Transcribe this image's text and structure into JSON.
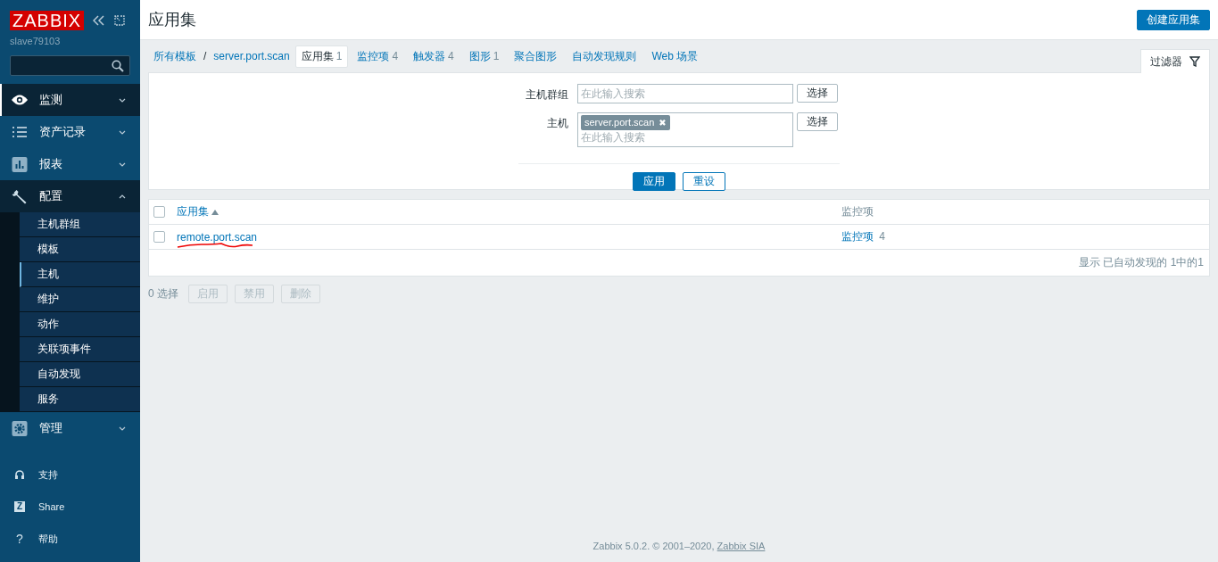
{
  "sidebar": {
    "logo": "ZABBIX",
    "server": "slave79103",
    "menu": [
      {
        "label": "监测",
        "selected": true,
        "expanded": false
      },
      {
        "label": "资产记录",
        "selected": false,
        "expanded": false
      },
      {
        "label": "报表",
        "selected": false,
        "expanded": false
      },
      {
        "label": "配置",
        "selected": true,
        "expanded": true,
        "children": [
          {
            "label": "主机群组",
            "selected": false
          },
          {
            "label": "模板",
            "selected": false
          },
          {
            "label": "主机",
            "selected": true
          },
          {
            "label": "维护",
            "selected": false
          },
          {
            "label": "动作",
            "selected": false
          },
          {
            "label": "关联项事件",
            "selected": false
          },
          {
            "label": "自动发现",
            "selected": false
          },
          {
            "label": "服务",
            "selected": false
          }
        ]
      },
      {
        "label": "管理",
        "selected": false,
        "expanded": false
      }
    ],
    "links": [
      {
        "label": "支持",
        "kind": "headset"
      },
      {
        "label": "Share",
        "kind": "glyph",
        "glyph": "Z"
      },
      {
        "label": "帮助",
        "kind": "plain",
        "glyph": "?"
      }
    ]
  },
  "header": {
    "title": "应用集",
    "create_button": "创建应用集"
  },
  "nav": [
    {
      "label": "所有模板",
      "kind": "link"
    },
    {
      "label": "/",
      "kind": "separator"
    },
    {
      "label": "server.port.scan",
      "kind": "link"
    },
    {
      "label": "应用集",
      "kind": "tab",
      "count": "1",
      "selected": true
    },
    {
      "label": "监控项",
      "kind": "tab",
      "count": "4",
      "selected": false
    },
    {
      "label": "触发器",
      "kind": "tab",
      "count": "4",
      "selected": false
    },
    {
      "label": "图形",
      "kind": "tab",
      "count": "1",
      "selected": false
    },
    {
      "label": "聚合图形",
      "kind": "tab",
      "selected": false
    },
    {
      "label": "自动发现规则",
      "kind": "tab",
      "selected": false
    },
    {
      "label": "Web 场景",
      "kind": "tab",
      "selected": false
    }
  ],
  "filter": {
    "tab": "过滤器",
    "fields": [
      {
        "label": "主机群组",
        "placeholder": "在此输入搜索",
        "button": "选择"
      },
      {
        "label": "主机",
        "tags": [
          {
            "label": "server.port.scan",
            "remove": "✖"
          }
        ],
        "placeholder": "在此输入搜索",
        "button": "选择"
      }
    ],
    "apply": "应用",
    "reset": "重设"
  },
  "table": {
    "select_all_checked": false,
    "columns": [
      {
        "label": "应用集",
        "sorted": true
      },
      {
        "label": "监控项"
      }
    ],
    "rows": [
      {
        "checked": false,
        "name": "remote.port.scan",
        "items_link": "监控项",
        "items_count": "4"
      }
    ],
    "summary": "显示 已自动发现的 1中的1"
  },
  "actions": {
    "selected_count": "0 选择",
    "buttons": [
      {
        "label": "启用",
        "disabled": true
      },
      {
        "label": "禁用",
        "disabled": true
      },
      {
        "label": "删除",
        "disabled": true
      }
    ]
  },
  "footer": {
    "text": "Zabbix 5.0.2. © 2001–2020,",
    "link": "Zabbix SIA"
  }
}
